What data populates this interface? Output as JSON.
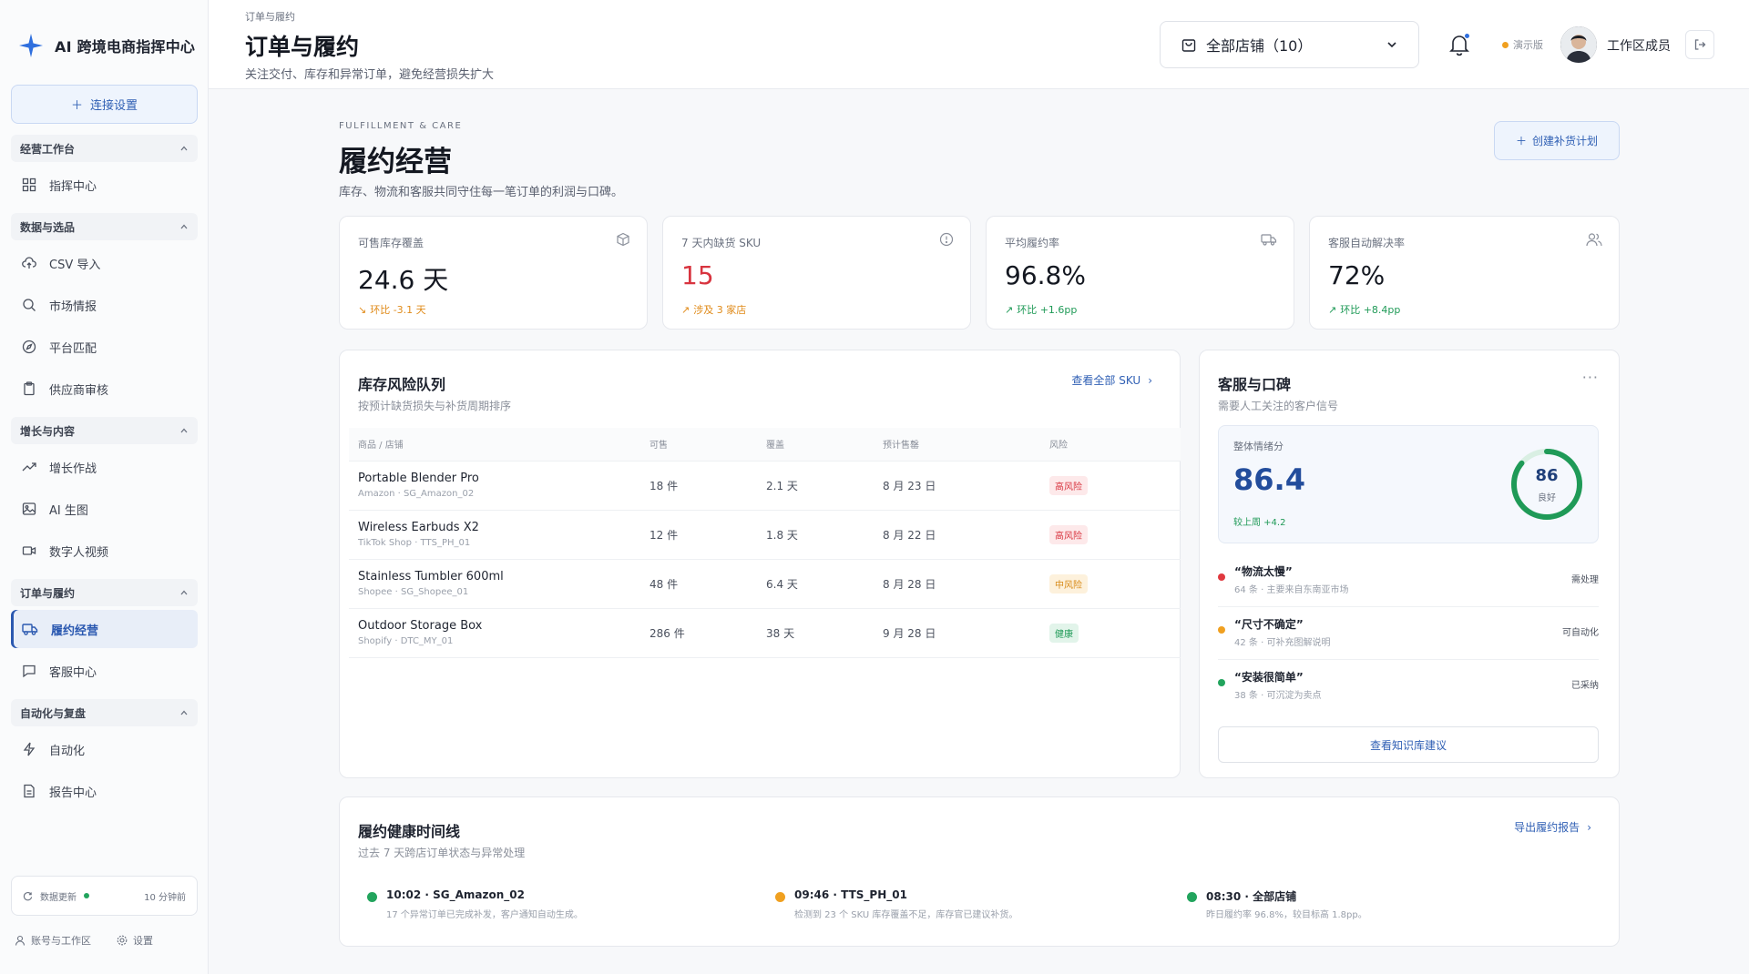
{
  "app": {
    "brand": "AI 跨境电商指挥中心"
  },
  "sidebar": {
    "connect_label": "连接设置",
    "groups": [
      {
        "label": "经营工作台",
        "items": [
          {
            "label": "指挥中心",
            "icon": "grid-icon"
          }
        ]
      },
      {
        "label": "数据与选品",
        "items": [
          {
            "label": "CSV 导入",
            "icon": "upload-cloud-icon"
          },
          {
            "label": "市场情报",
            "icon": "search-icon"
          },
          {
            "label": "平台匹配",
            "icon": "compass-icon"
          },
          {
            "label": "供应商审核",
            "icon": "clipboard-icon"
          }
        ]
      },
      {
        "label": "增长与内容",
        "items": [
          {
            "label": "增长作战",
            "icon": "trend-up-icon"
          },
          {
            "label": "AI 生图",
            "icon": "image-icon"
          },
          {
            "label": "数字人视频",
            "icon": "video-icon"
          }
        ]
      },
      {
        "label": "订单与履约",
        "items": [
          {
            "label": "履约经营",
            "icon": "truck-icon",
            "active": true
          },
          {
            "label": "客服中心",
            "icon": "chat-icon"
          }
        ]
      },
      {
        "label": "自动化与复盘",
        "items": [
          {
            "label": "自动化",
            "icon": "bolt-icon"
          },
          {
            "label": "报告中心",
            "icon": "file-icon"
          }
        ]
      }
    ],
    "status": {
      "label": "数据更新",
      "time": "10 分钟前"
    },
    "footer": {
      "account": "账号与工作区",
      "settings": "设置"
    }
  },
  "header": {
    "breadcrumb": "订单与履约",
    "title": "订单与履约",
    "subtitle": "关注交付、库存和异常订单，避免经营损失扩大",
    "store_select": "全部店铺（10）",
    "demo_label": "演示版",
    "user_name": "工作区成员"
  },
  "main": {
    "eyebrow": "FULFILLMENT & CARE",
    "title": "履约经营",
    "subtitle": "库存、物流和客服共同守住每一笔订单的利润与口碑。",
    "plan_button": "创建补货计划",
    "kpis": [
      {
        "label": "可售库存覆盖",
        "value": "24.6 天",
        "trend": "环比 -3.1 天",
        "trend_color": "#e08b1a",
        "icon": "box-icon"
      },
      {
        "label": "7 天内缺货 SKU",
        "value": "15",
        "trend": "涉及 3 家店",
        "trend_color": "#e08b1a",
        "icon": "alert-circle-icon",
        "value_color": "#d8343f"
      },
      {
        "label": "平均履约率",
        "value": "96.8%",
        "trend": "环比 +1.6pp",
        "trend_color": "#1f9a57",
        "icon": "truck-icon"
      },
      {
        "label": "客服自动解决率",
        "value": "72%",
        "trend": "环比 +8.4pp",
        "trend_color": "#1f9a57",
        "icon": "users-icon"
      }
    ],
    "inventory": {
      "title": "库存风险队列",
      "subtitle": "按预计缺货损失与补货周期排序",
      "link": "查看全部 SKU",
      "columns": [
        "商品 / 店铺",
        "可售",
        "覆盖",
        "预计售罄",
        "风险"
      ],
      "rows": [
        {
          "name": "Portable Blender Pro",
          "store": "Amazon · SG_Amazon_02",
          "stock": "18 件",
          "cover": "2.1 天",
          "soldout": "8 月 23 日",
          "risk": "高风险",
          "level": "high"
        },
        {
          "name": "Wireless Earbuds X2",
          "store": "TikTok Shop · TTS_PH_01",
          "stock": "12 件",
          "cover": "1.8 天",
          "soldout": "8 月 22 日",
          "risk": "高风险",
          "level": "high"
        },
        {
          "name": "Stainless Tumbler 600ml",
          "store": "Shopee · SG_Shopee_01",
          "stock": "48 件",
          "cover": "6.4 天",
          "soldout": "8 月 28 日",
          "risk": "中风险",
          "level": "mid"
        },
        {
          "name": "Outdoor Storage Box",
          "store": "Shopify · DTC_MY_01",
          "stock": "286 件",
          "cover": "38 天",
          "soldout": "9 月 28 日",
          "risk": "健康",
          "level": "ok"
        }
      ]
    },
    "service": {
      "title": "客服与口碑",
      "subtitle": "需要人工关注的客户信号",
      "score_label": "整体情绪分",
      "score_value": "86.4",
      "score_trend": "较上周 +4.2",
      "gauge_value": "86",
      "gauge_fraction": 0.86,
      "gauge_label": "良好",
      "signals": [
        {
          "title": "“物流太慢”",
          "meta": "64 条 · 主要来自东南亚市场",
          "status": "需处理",
          "color": "#e0393f"
        },
        {
          "title": "“尺寸不确定”",
          "meta": "42 条 · 可补充图解说明",
          "status": "可自动化",
          "color": "#f0a020"
        },
        {
          "title": "“安装很简单”",
          "meta": "38 条 · 可沉淀为卖点",
          "status": "已采纳",
          "color": "#22a45d"
        }
      ],
      "kb_button": "查看知识库建议"
    },
    "timeline": {
      "title": "履约健康时间线",
      "subtitle": "过去 7 天跨店订单状态与异常处理",
      "link": "导出履约报告",
      "events": [
        {
          "title": "10:02 · SG_Amazon_02",
          "desc": "17 个异常订单已完成补发，客户通知自动生成。",
          "color": "#22a45d"
        },
        {
          "title": "09:46 · TTS_PH_01",
          "desc": "检测到 23 个 SKU 库存覆盖不足，库存官已建议补货。",
          "color": "#f0a020"
        },
        {
          "title": "08:30 · 全部店铺",
          "desc": "昨日履约率 96.8%，较目标高 1.8pp。",
          "color": "#22a45d"
        }
      ]
    }
  }
}
